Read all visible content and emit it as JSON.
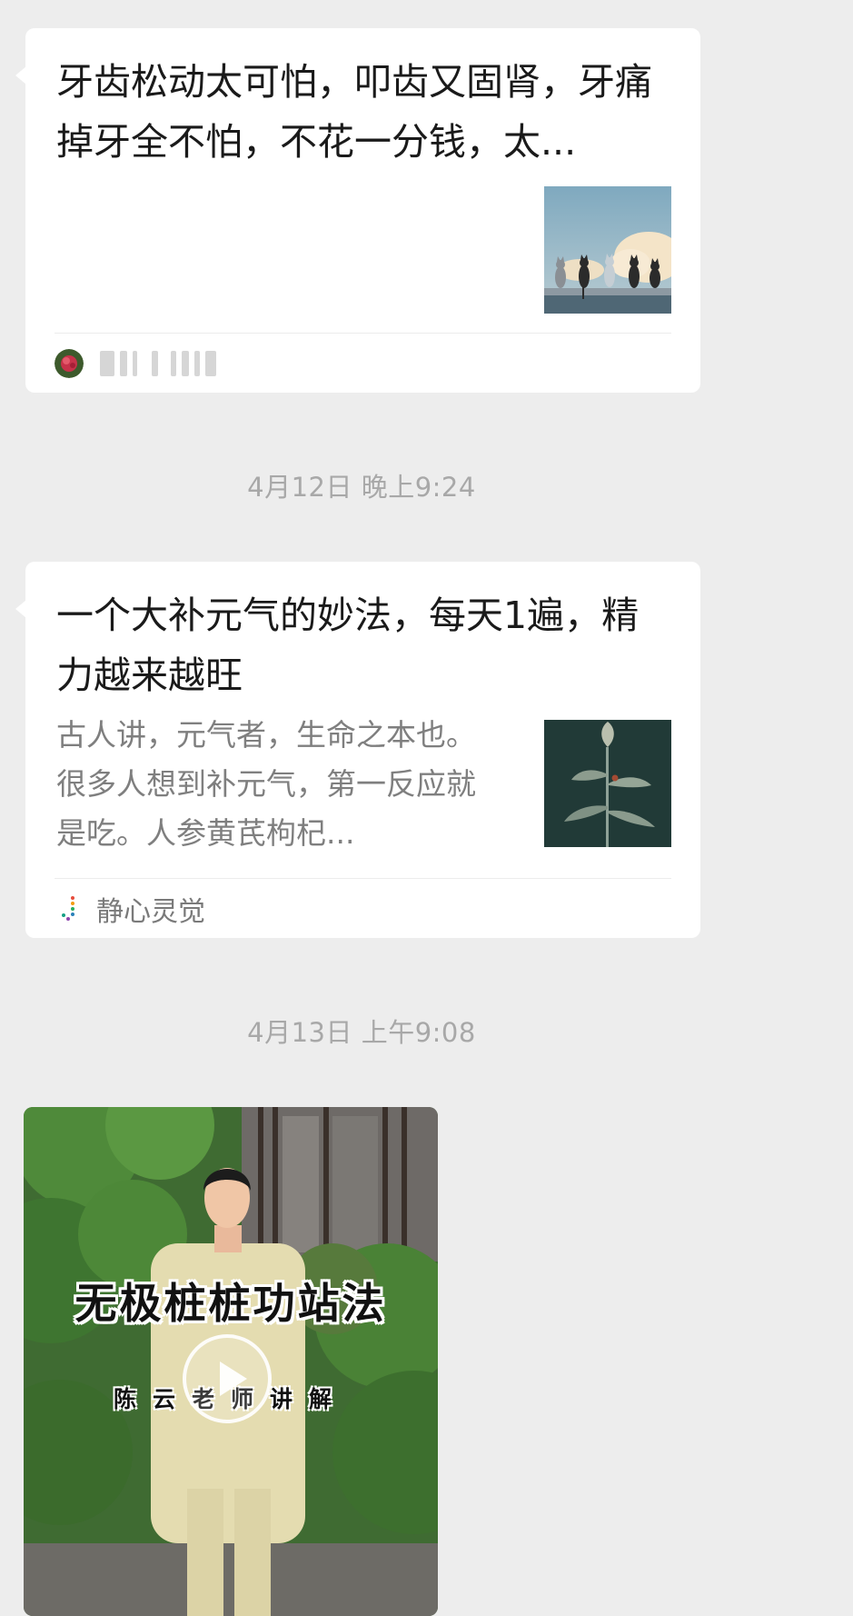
{
  "messages": [
    {
      "title": "牙齿松动太可怕，叩齿又固肾，牙痛掉牙全不怕，不花一分钱，太...",
      "thumbnail": "cats-on-wall-sky-image",
      "source_name_redacted": true
    },
    {
      "timestamp": "4月12日 晚上9:24",
      "title": "一个大补元气的妙法，每天1遍，精力越来越旺",
      "description": "古人讲，元气者，生命之本也。很多人想到补元气，第一反应就是吃。人参黄芪枸杞...",
      "thumbnail": "flower-bud-dark-image",
      "source_name": "静心灵觉"
    },
    {
      "timestamp": "4月13日 上午9:08",
      "video": {
        "title": "无极桩桩功站法",
        "subtitle": "陈云老师讲解"
      }
    }
  ],
  "icons": {
    "play": "play-icon"
  },
  "colors": {
    "background": "#ededed",
    "card": "#ffffff",
    "title_text": "#1a1a1a",
    "desc_text": "#7f7f7f",
    "timestamp_text": "#a8a8a8"
  }
}
